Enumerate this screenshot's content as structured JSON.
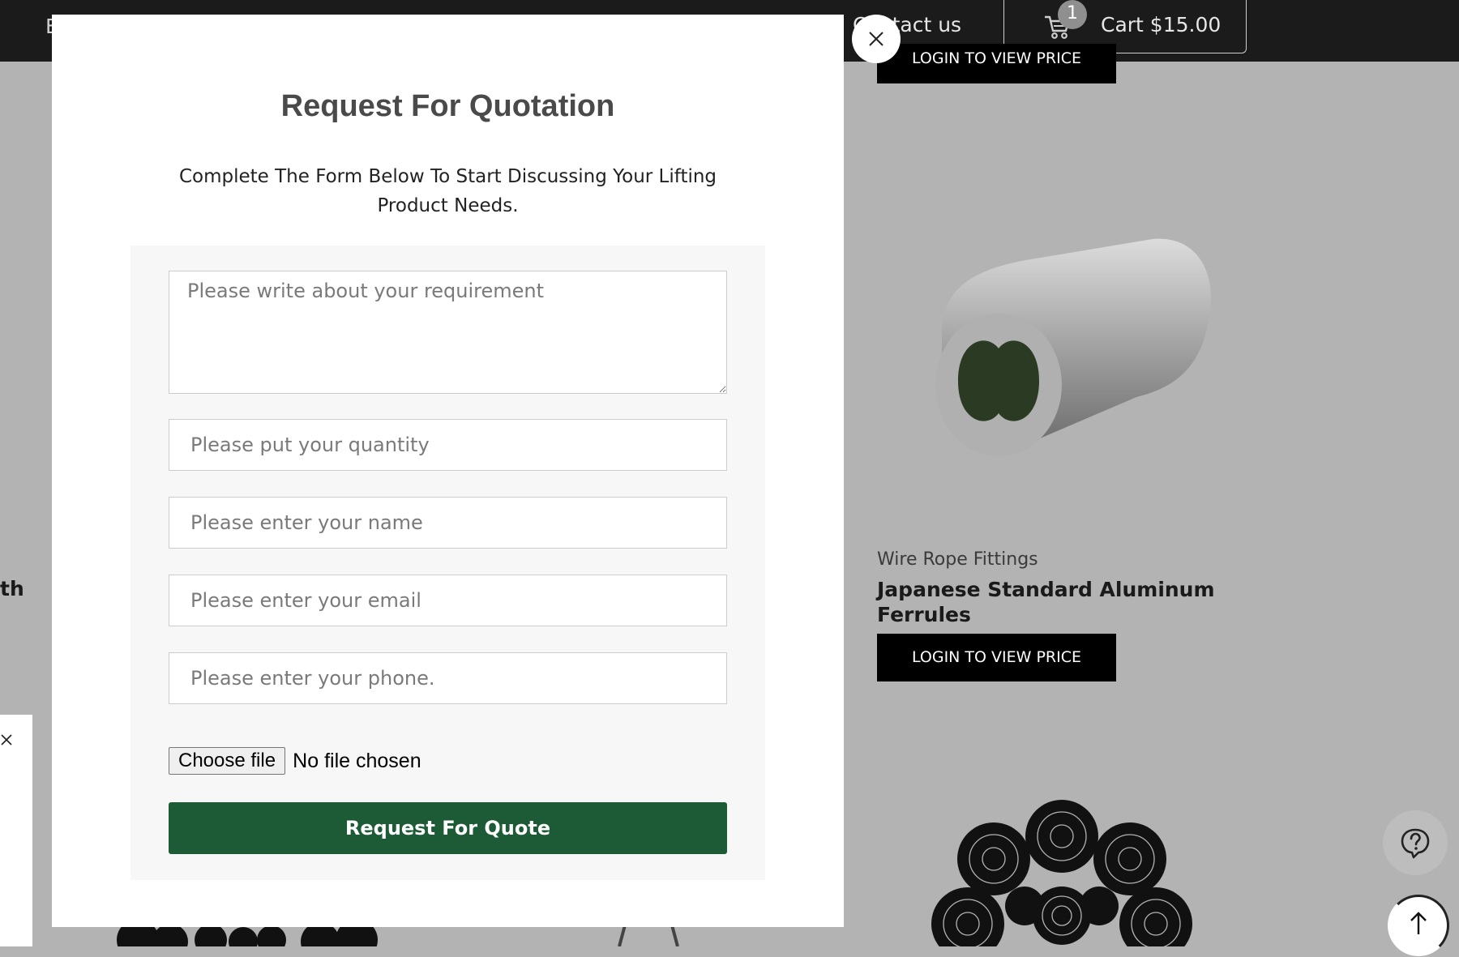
{
  "header": {
    "nav_left_fragment": "E",
    "nav_contact": "Contact us",
    "cart_count": "1",
    "cart_label": "Cart $15.00"
  },
  "background": {
    "top_product_button": "LOGIN TO VIEW PRICE",
    "product": {
      "category": "Wire Rope Fittings",
      "title": "Japanese Standard Aluminum Ferrules",
      "button": "LOGIN TO VIEW PRICE"
    },
    "left_fragment": "th"
  },
  "modal": {
    "title": "Request For Quotation",
    "subtitle": "Complete The Form Below To Start Discussing Your Lifting Product Needs.",
    "fields": {
      "requirement_placeholder": "Please write about your requirement",
      "quantity_placeholder": "Please put your quantity",
      "name_placeholder": "Please enter your name",
      "email_placeholder": "Please enter your email",
      "phone_placeholder": "Please enter your phone."
    },
    "file": {
      "button_label": "Choose file",
      "status": "No file chosen"
    },
    "submit_label": "Request For Quote"
  },
  "icons": {
    "close": "close-icon",
    "cart": "cart-icon",
    "help": "help-icon",
    "scroll_top": "arrow-up-icon"
  },
  "colors": {
    "submit_button": "#1c5b35",
    "overlay": "#b3b3b3",
    "header": "#1b1b1b"
  }
}
